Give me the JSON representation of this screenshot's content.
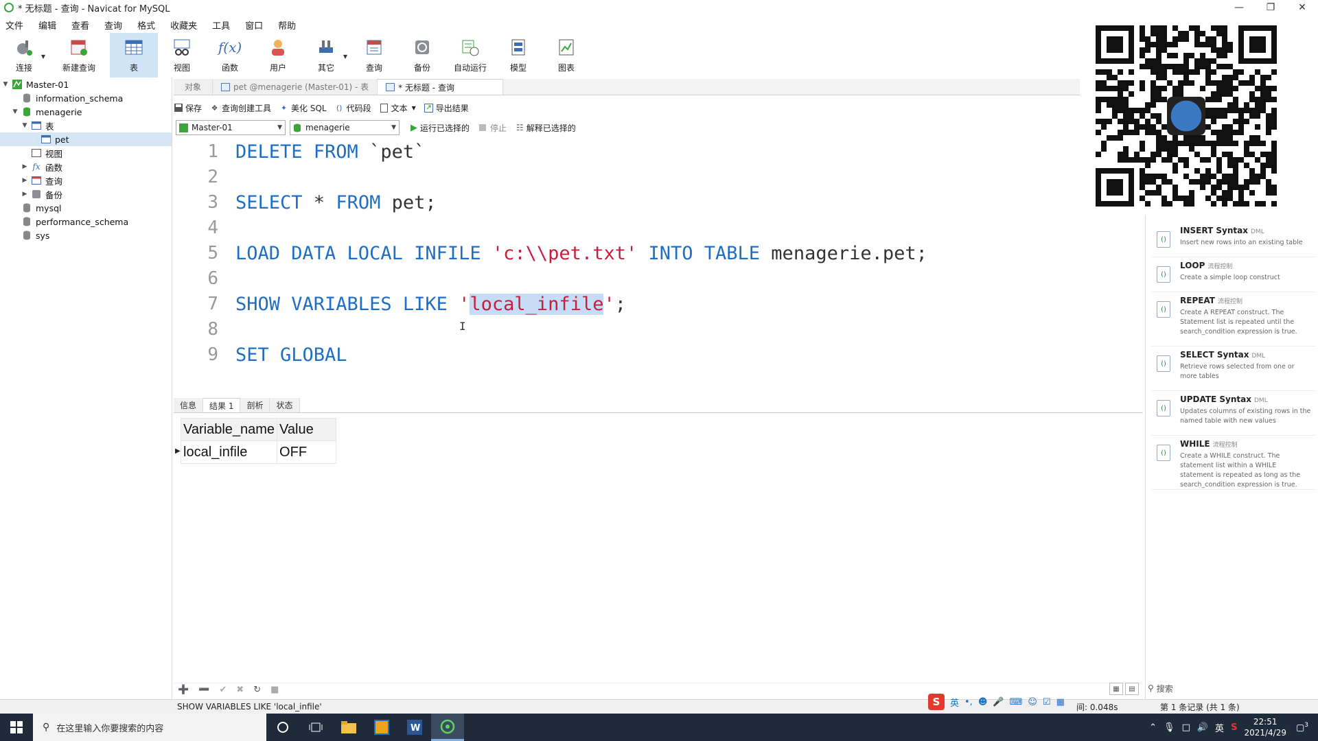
{
  "window": {
    "title": "* 无标题 - 查询 - Navicat for MySQL"
  },
  "menu": [
    "文件",
    "编辑",
    "查看",
    "查询",
    "格式",
    "收藏夹",
    "工具",
    "窗口",
    "帮助"
  ],
  "ribbon": [
    "连接",
    "新建查询",
    "表",
    "视图",
    "函数",
    "用户",
    "其它",
    "查询",
    "备份",
    "自动运行",
    "模型",
    "图表"
  ],
  "tree": {
    "connection": "Master-01",
    "databases": [
      "information_schema",
      "menagerie",
      "mysql",
      "performance_schema",
      "sys"
    ],
    "groups": [
      "表",
      "视图",
      "函数",
      "查询",
      "备份"
    ],
    "table": "pet"
  },
  "tabs": [
    "对象",
    "pet @menagerie (Master-01) - 表",
    "* 无标题 - 查询"
  ],
  "query_toolbar": [
    "保存",
    "查询创建工具",
    "美化 SQL",
    "代码段",
    "文本",
    "导出结果"
  ],
  "selectors": {
    "connection": "Master-01",
    "database": "menagerie"
  },
  "run_buttons": [
    "运行已选择的",
    "停止",
    "解释已选择的"
  ],
  "editor": {
    "line_numbers": [
      "1",
      "2",
      "3",
      "4",
      "5",
      "6",
      "7",
      "8",
      "9"
    ],
    "l1": {
      "kw": "DELETE FROM",
      "rest": " `pet`"
    },
    "l3": {
      "kw1": "SELECT",
      "mid": " * ",
      "kw2": "FROM",
      "rest": " pet;"
    },
    "l5": {
      "kw": "LOAD DATA LOCAL INFILE",
      "str": "'c:\\\\pet.txt'",
      "kw2": "INTO TABLE",
      "rest": " menagerie.pet;"
    },
    "l7": {
      "kw": "SHOW VARIABLES LIKE",
      "q1": "'",
      "sel": "local_infile",
      "q2": "'",
      "rest": ";"
    },
    "l9": {
      "kw": "SET GLOBAL"
    },
    "cursor": "I"
  },
  "result_tabs": [
    "信息",
    "结果 1",
    "剖析",
    "状态"
  ],
  "result": {
    "columns": [
      "Variable_name",
      "Value"
    ],
    "rows": [
      [
        "local_infile",
        "OFF"
      ]
    ]
  },
  "snippets": [
    {
      "name": "INSERT Syntax",
      "tag": "DML",
      "desc": "Insert new rows into an existing table"
    },
    {
      "name": "LOOP",
      "tag": "流程控制",
      "desc": "Create a simple loop construct"
    },
    {
      "name": "REPEAT",
      "tag": "流程控制",
      "desc": "Create A REPEAT construct. The Statement list is repeated until the search_condition expression is true."
    },
    {
      "name": "SELECT Syntax",
      "tag": "DML",
      "desc": "Retrieve rows selected from one or more tables"
    },
    {
      "name": "UPDATE Syntax",
      "tag": "DML",
      "desc": "Updates columns of existing rows in the named table with new values"
    },
    {
      "name": "WHILE",
      "tag": "流程控制",
      "desc": "Create a WHILE construct. The statement list within a WHILE statement is repeated as long as the search_condition expression is true."
    }
  ],
  "snippet_search": "搜索",
  "status": {
    "sql": "SHOW VARIABLES LIKE 'local_infile'",
    "time": "间: 0.048s",
    "records": "第 1 条记录 (共 1 条)"
  },
  "ime": {
    "lang": "英"
  },
  "taskbar": {
    "search_placeholder": "在这里输入你要搜索的内容",
    "tray_lang": "英",
    "time": "22:51",
    "date": "2021/4/29",
    "notifications": "3"
  }
}
